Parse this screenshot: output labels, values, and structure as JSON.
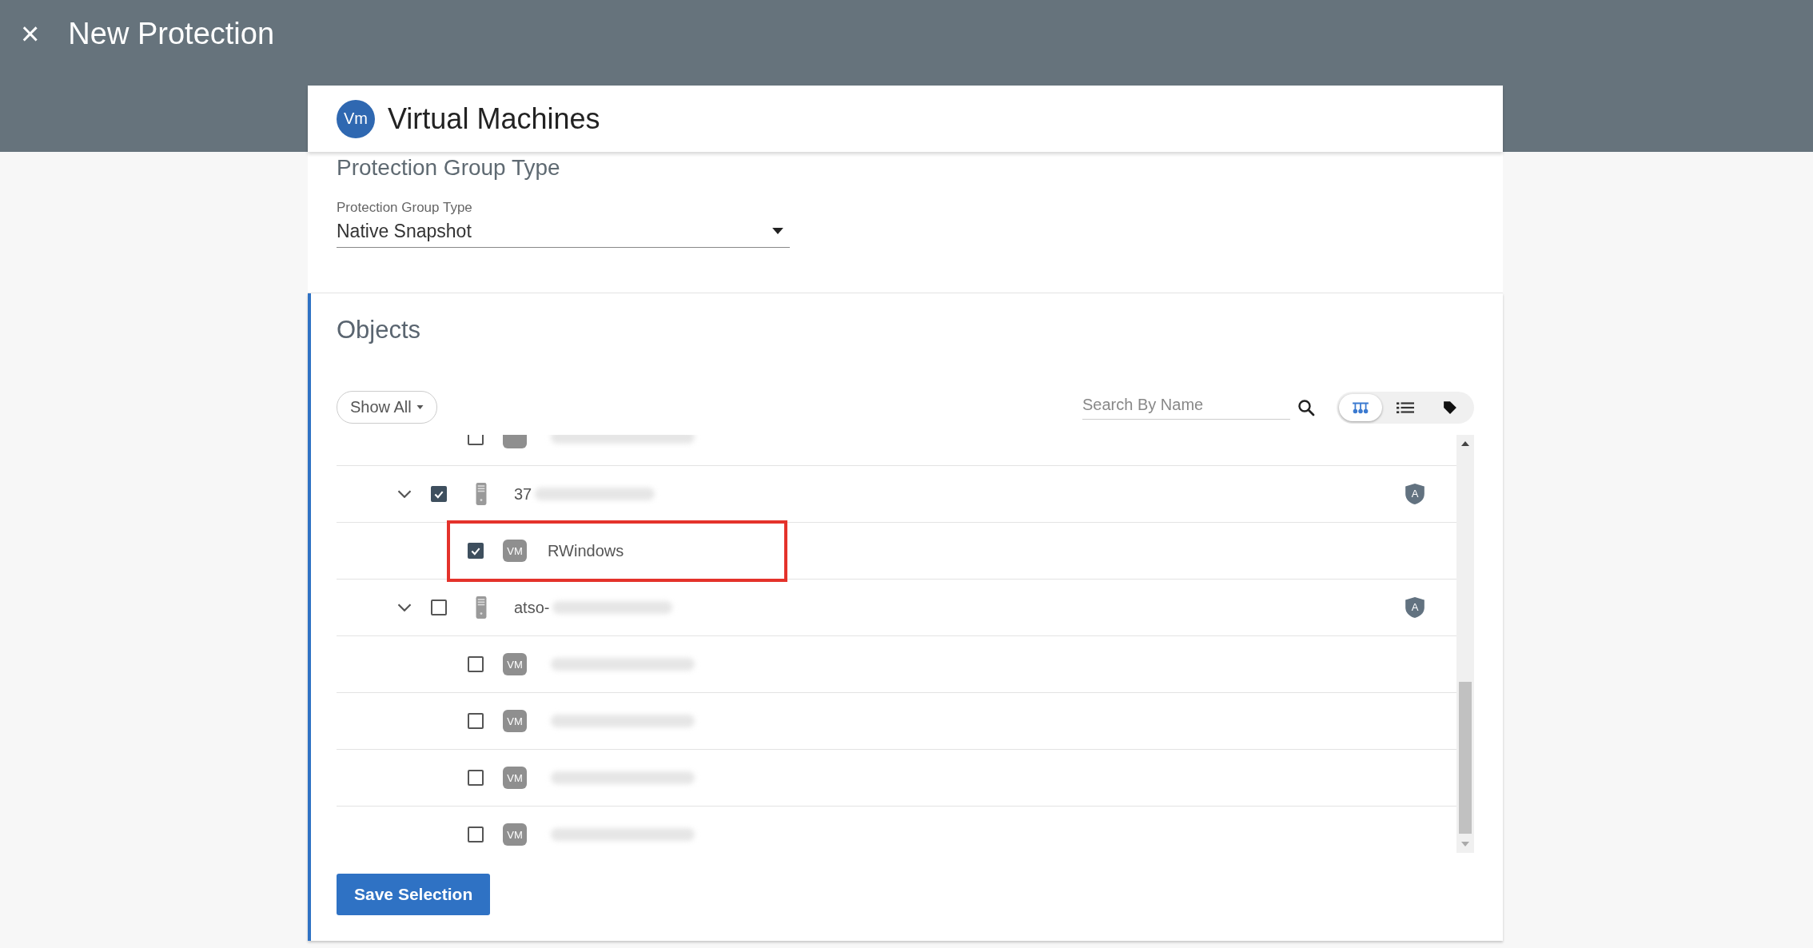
{
  "header": {
    "close_glyph": "×",
    "title": "New Protection"
  },
  "source": {
    "badge": "Vm",
    "title": "Virtual Machines"
  },
  "group_type": {
    "section_title": "Protection Group Type",
    "label": "Protection Group Type",
    "value": "Native Snapshot"
  },
  "objects": {
    "title": "Objects",
    "filter": "Show All",
    "search": {
      "placeholder": "Search By Name"
    },
    "views": [
      {
        "kind": "tree",
        "selected": true
      },
      {
        "kind": "list",
        "selected": false
      },
      {
        "kind": "tag",
        "selected": false
      }
    ],
    "tree": [
      {
        "kind": "vm",
        "checked": false,
        "redacted": true
      },
      {
        "kind": "host",
        "checked": true,
        "expanded": true,
        "name": "37",
        "redacted": true,
        "policy_badge": "A",
        "children": [
          {
            "kind": "vm",
            "checked": true,
            "badge": "VM",
            "name": "RWindows",
            "redacted": false,
            "highlighted": true
          }
        ]
      },
      {
        "kind": "host",
        "checked": false,
        "expanded": true,
        "name": "atso-",
        "redacted": true,
        "policy_badge": "A",
        "children": [
          {
            "kind": "vm",
            "checked": false,
            "badge": "VM",
            "redacted": true
          },
          {
            "kind": "vm",
            "checked": false,
            "badge": "VM",
            "redacted": true
          },
          {
            "kind": "vm",
            "checked": false,
            "badge": "VM",
            "redacted": true
          },
          {
            "kind": "vm",
            "checked": false,
            "badge": "VM",
            "redacted": true
          }
        ]
      }
    ]
  },
  "save_button": "Save Selection"
}
